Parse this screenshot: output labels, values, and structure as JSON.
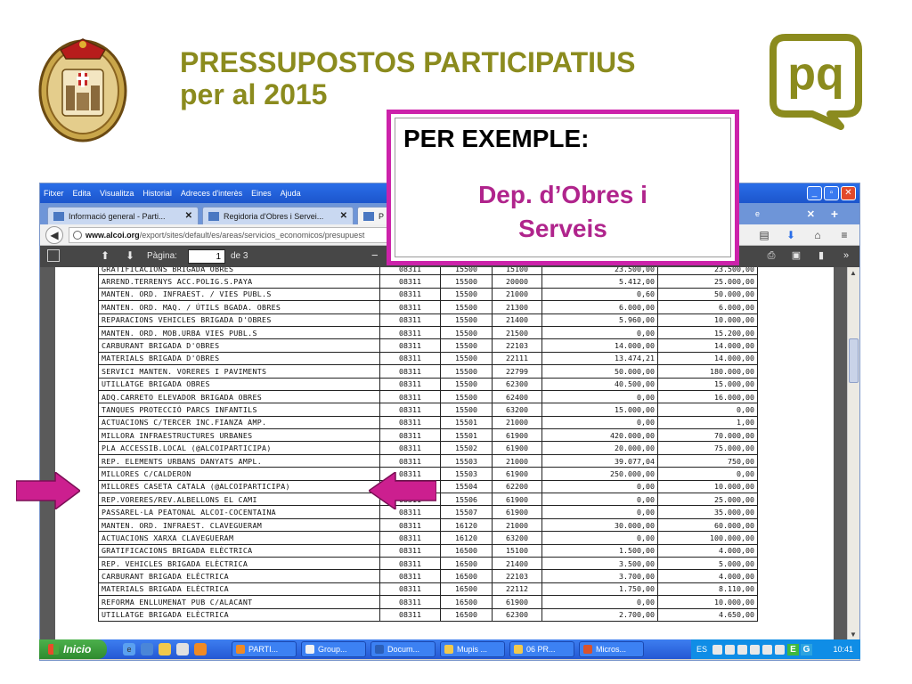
{
  "slide": {
    "title_line1": "PRESSUPOSTOS PARTICIPATIUS",
    "title_line2": "per al 2015",
    "callout_heading": "PER EXEMPLE:",
    "callout_dept_line1": "Dep. d’Obres i",
    "callout_dept_line2": "Serveis",
    "logo_text": "pq",
    "colors": {
      "title": "#8b8b1e",
      "callout_border": "#cc22aa",
      "callout_text": "#b0248c",
      "arrow": "#cc1f8f"
    }
  },
  "browser": {
    "menu": [
      "Fitxer",
      "Edita",
      "Visualitza",
      "Historial",
      "Adreces d'interès",
      "Eines",
      "Ajuda"
    ],
    "tabs": [
      {
        "label": "Informació general - Parti...",
        "active": false
      },
      {
        "label": "Regidoria d'Obres i Servei...",
        "active": false
      },
      {
        "label": "P",
        "active": true
      }
    ],
    "tab_extra_label": "e",
    "url_domain": "www.alcoi.org",
    "url_path": "/export/sites/default/es/areas/servicios_economicos/presupuest",
    "pdf": {
      "page_label": "Pàgina:",
      "page_value": "1",
      "page_of": "de 3"
    }
  },
  "table": {
    "rows": [
      [
        "GRATIFICACIONS BRIGADA OBRES",
        "08311",
        "15500",
        "15100",
        "23.500,00",
        "23.500,00"
      ],
      [
        "ARREND.TERRENYS ACC.POLIG.S.PAYA",
        "08311",
        "15500",
        "20000",
        "5.412,00",
        "25.000,00"
      ],
      [
        "MANTEN. ORD. INFRAEST. / VIES PUBL.S",
        "08311",
        "15500",
        "21000",
        "0,60",
        "50.000,00"
      ],
      [
        "MANTEN. ORD. MAQ. / ÚTILS BGADA. OBRES",
        "08311",
        "15500",
        "21300",
        "6.000,00",
        "6.000,00"
      ],
      [
        "REPARACIONS VEHICLES BRIGADA D'OBRES",
        "08311",
        "15500",
        "21400",
        "5.960,00",
        "10.000,00"
      ],
      [
        "MANTEN. ORD. MOB.URBA VIES PUBL.S",
        "08311",
        "15500",
        "21500",
        "0,00",
        "15.200,00"
      ],
      [
        "CARBURANT BRIGADA D'OBRES",
        "08311",
        "15500",
        "22103",
        "14.000,00",
        "14.000,00"
      ],
      [
        "MATERIALS BRIGADA D'OBRES",
        "08311",
        "15500",
        "22111",
        "13.474,21",
        "14.000,00"
      ],
      [
        "SERVICI MANTEN. VORERES I PAVIMENTS",
        "08311",
        "15500",
        "22799",
        "50.000,00",
        "180.000,00"
      ],
      [
        "UTILLATGE BRIGADA OBRES",
        "08311",
        "15500",
        "62300",
        "40.500,00",
        "15.000,00"
      ],
      [
        "ADQ.CARRETO ELEVADOR BRIGADA OBRES",
        "08311",
        "15500",
        "62400",
        "0,00",
        "16.000,00"
      ],
      [
        "TANQUES PROTECCIÓ PARCS INFANTILS",
        "08311",
        "15500",
        "63200",
        "15.000,00",
        "0,00"
      ],
      [
        "ACTUACIONS C/TERCER INC.FIANZA AMP.",
        "08311",
        "15501",
        "21000",
        "0,00",
        "1,00"
      ],
      [
        "MILLORA INFRAESTRUCTURES URBANES",
        "08311",
        "15501",
        "61900",
        "420.000,00",
        "70.000,00"
      ],
      [
        "PLA ACCESSIB.LOCAL (@ALCOIPARTICIPA)",
        "08311",
        "15502",
        "61900",
        "20.000,00",
        "75.000,00"
      ],
      [
        "REP. ELEMENTS URBANS DANYATS AMPL.",
        "08311",
        "15503",
        "21000",
        "39.077,04",
        "750,00"
      ],
      [
        "MILLORES C/CALDERON",
        "08311",
        "15503",
        "61900",
        "250.000,00",
        "0,00"
      ],
      [
        "MILLORES CASETA CATALA (@ALCOIPARTICIPA)",
        "08311",
        "15504",
        "62200",
        "0,00",
        "10.000,00"
      ],
      [
        "REP.VORERES/REV.ALBELLONS EL CAMI",
        "08311",
        "15506",
        "61900",
        "0,00",
        "25.000,00"
      ],
      [
        "PASSAREL·LA PEATONAL ALCOI-COCENTAINA",
        "08311",
        "15507",
        "61900",
        "0,00",
        "35.000,00"
      ],
      [
        "MANTEN. ORD. INFRAEST. CLAVEGUERAM",
        "08311",
        "16120",
        "21000",
        "30.000,00",
        "60.000,00"
      ],
      [
        "ACTUACIONS XARXA CLAVEGUERAM",
        "08311",
        "16120",
        "63200",
        "0,00",
        "100.000,00"
      ],
      [
        "GRATIFICACIONS BRIGADA ELÈCTRICA",
        "08311",
        "16500",
        "15100",
        "1.500,00",
        "4.000,00"
      ],
      [
        "REP. VEHICLES BRIGADA ELÈCTRICA",
        "08311",
        "16500",
        "21400",
        "3.500,00",
        "5.000,00"
      ],
      [
        "CARBURANT BRIGADA ELÈCTRICA",
        "08311",
        "16500",
        "22103",
        "3.700,00",
        "4.000,00"
      ],
      [
        "MATERIALS BRIGADA ELÈCTRICA",
        "08311",
        "16500",
        "22112",
        "1.750,00",
        "8.110,00"
      ],
      [
        "REFORMA ENLLUMENAT PUB C/ALACANT",
        "08311",
        "16500",
        "61900",
        "0,00",
        "10.000,00"
      ],
      [
        "UTILLATGE BRIGADA ELÈCTRICA",
        "08311",
        "16500",
        "62300",
        "2.700,00",
        "4.650,00"
      ]
    ]
  },
  "taskbar": {
    "start_label": "Inicio",
    "items": [
      "PARTI...",
      "Group...",
      "Docum...",
      "Mupis ...",
      "06 PR...",
      "Micros..."
    ],
    "lang": "ES",
    "tray_e": "E",
    "tray_g": "G",
    "clock": "10:41"
  }
}
